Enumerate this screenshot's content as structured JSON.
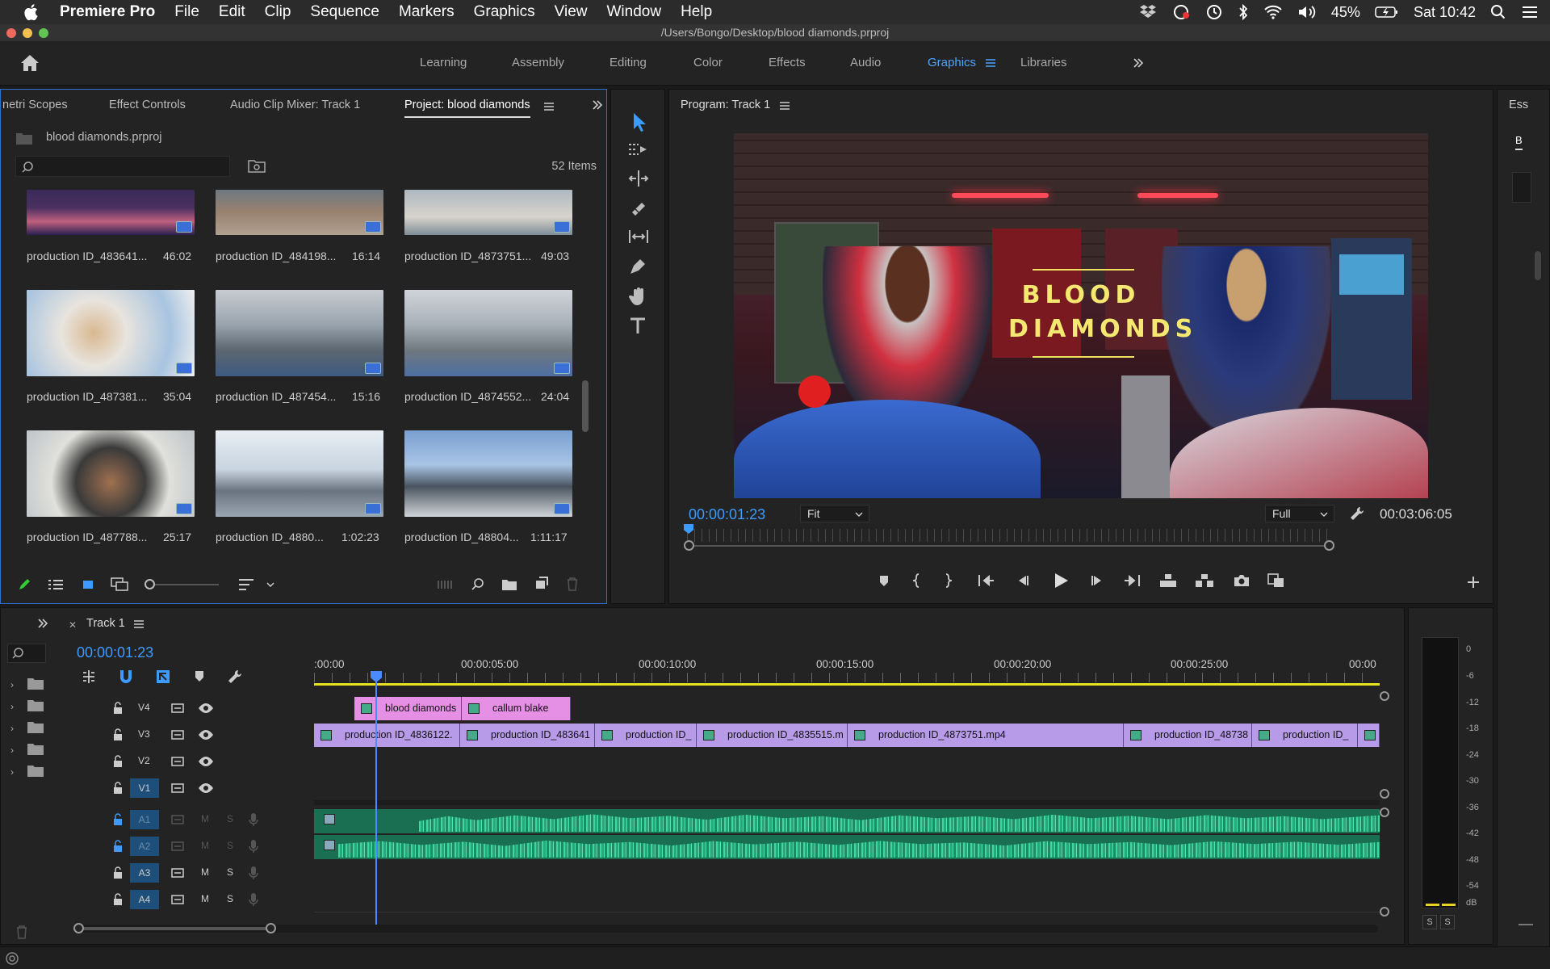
{
  "menubar": {
    "items": [
      "Premiere Pro",
      "File",
      "Edit",
      "Clip",
      "Sequence",
      "Markers",
      "Graphics",
      "View",
      "Window",
      "Help"
    ],
    "battery": "45%",
    "clock": "Sat 10:42"
  },
  "window": {
    "title": "/Users/Bongo/Desktop/blood diamonds.prproj"
  },
  "workspaces": {
    "items": [
      "Learning",
      "Assembly",
      "Editing",
      "Color",
      "Effects",
      "Audio",
      "Graphics",
      "Libraries"
    ],
    "active": "Graphics"
  },
  "project_panel": {
    "tabs": [
      "netri Scopes",
      "Effect Controls",
      "Audio Clip Mixer: Track 1",
      "Project: blood diamonds"
    ],
    "file_name": "blood diamonds.prproj",
    "item_count": "52 Items",
    "search": {
      "value": "",
      "placeholder": ""
    },
    "items": [
      {
        "name": "production ID_483641...",
        "duration": "46:02"
      },
      {
        "name": "production ID_484198...",
        "duration": "16:14"
      },
      {
        "name": "production ID_4873751...",
        "duration": "49:03"
      },
      {
        "name": "production ID_487381...",
        "duration": "35:04"
      },
      {
        "name": "production ID_487454...",
        "duration": "15:16"
      },
      {
        "name": "production ID_4874552...",
        "duration": "24:04"
      },
      {
        "name": "production ID_487788...",
        "duration": "25:17"
      },
      {
        "name": "production ID_4880...",
        "duration": "1:02:23"
      },
      {
        "name": "production ID_48804...",
        "duration": "1:11:17"
      }
    ]
  },
  "program_monitor": {
    "title": "Program: Track 1",
    "title_overlay": [
      "BLOOD",
      "DIAMONDS"
    ],
    "current_tc": "00:00:01:23",
    "fit": "Fit",
    "resolution": "Full",
    "duration_tc": "00:03:06:05"
  },
  "essentials": {
    "tab": "Ess",
    "label": "B"
  },
  "timeline": {
    "tab": "Track 1",
    "current_tc": "00:00:01:23",
    "ruler": [
      ":00:00",
      "00:00:05:00",
      "00:00:10:00",
      "00:00:15:00",
      "00:00:20:00",
      "00:00:25:00",
      "00:00"
    ],
    "tracks": [
      {
        "name": "V4",
        "kind": "video"
      },
      {
        "name": "V3",
        "kind": "video"
      },
      {
        "name": "V2",
        "kind": "video"
      },
      {
        "name": "V1",
        "kind": "video"
      },
      {
        "name": "A1",
        "kind": "audio"
      },
      {
        "name": "A2",
        "kind": "audio"
      },
      {
        "name": "A3",
        "kind": "audio"
      },
      {
        "name": "A4",
        "kind": "audio"
      }
    ],
    "graphic_clips": [
      "blood diamonds",
      "callum blake"
    ],
    "video_clips": [
      "production ID_4836122.",
      "production ID_483641",
      "production ID_",
      "production ID_4835515.m",
      "production ID_4873751.mp4",
      "production ID_48738",
      "production ID_"
    ],
    "mute_label": "M",
    "solo_label": "S"
  },
  "audio_meter": {
    "scale": [
      "0",
      "-6",
      "-12",
      "-18",
      "-24",
      "-30",
      "-36",
      "-42",
      "-48",
      "-54",
      "dB"
    ],
    "solo_buttons": [
      "S",
      "S"
    ]
  },
  "colors": {
    "accent": "#3d9bff",
    "graphic_clip": "#e58fe5",
    "video_clip": "#b79be8",
    "audio_clip": "#1f8a66",
    "playhead": "#4a8cff"
  }
}
